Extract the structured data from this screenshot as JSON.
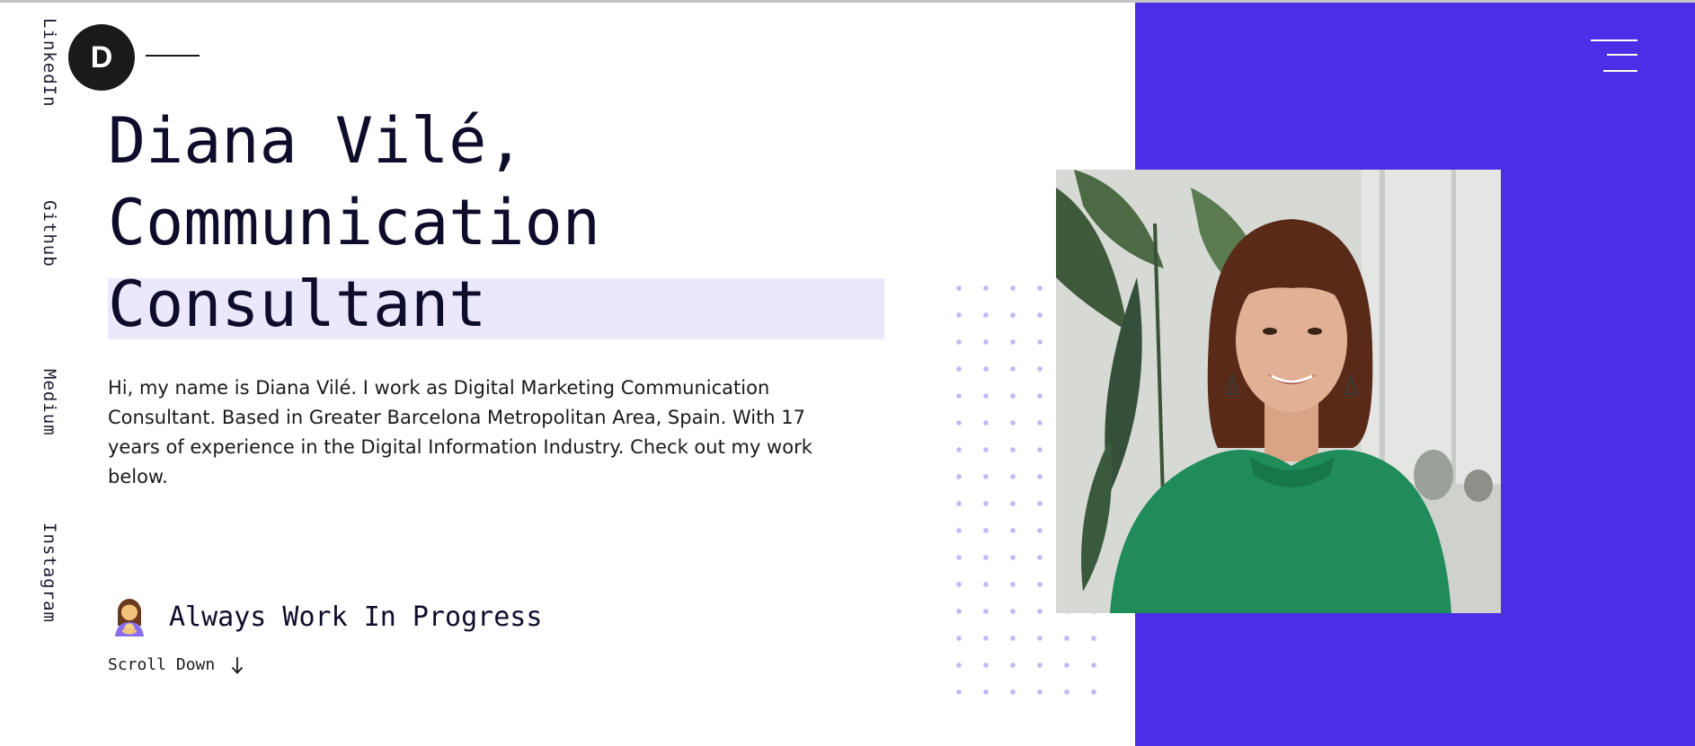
{
  "brand": {
    "logo_letter": "D"
  },
  "social_links": [
    {
      "label": "LinkedIn"
    },
    {
      "label": "Github"
    },
    {
      "label": "Medium"
    },
    {
      "label": "Instagram"
    }
  ],
  "hero": {
    "headline_lines": [
      "Diana Vilé,",
      "Communication",
      "Consultant"
    ],
    "intro": "Hi, my name is Diana Vilé. I work as Digital Marketing Communication Consultant. Based in Greater Barcelona Metropolitan Area, Spain. With 17 years of experience in the Digital Information Industry. Check out my work below.",
    "status_icon": "woman-feeding-baby-icon",
    "status_text": "Always Work In Progress",
    "scroll_label": "Scroll Down",
    "scroll_icon": "arrow-down-icon"
  },
  "nav": {
    "menu_icon": "hamburger-menu-icon"
  },
  "colors": {
    "accent": "#4a2fe6",
    "highlight": "#ebe8fc",
    "dots": "#c3b9f3",
    "text": "#0d0d2b"
  }
}
